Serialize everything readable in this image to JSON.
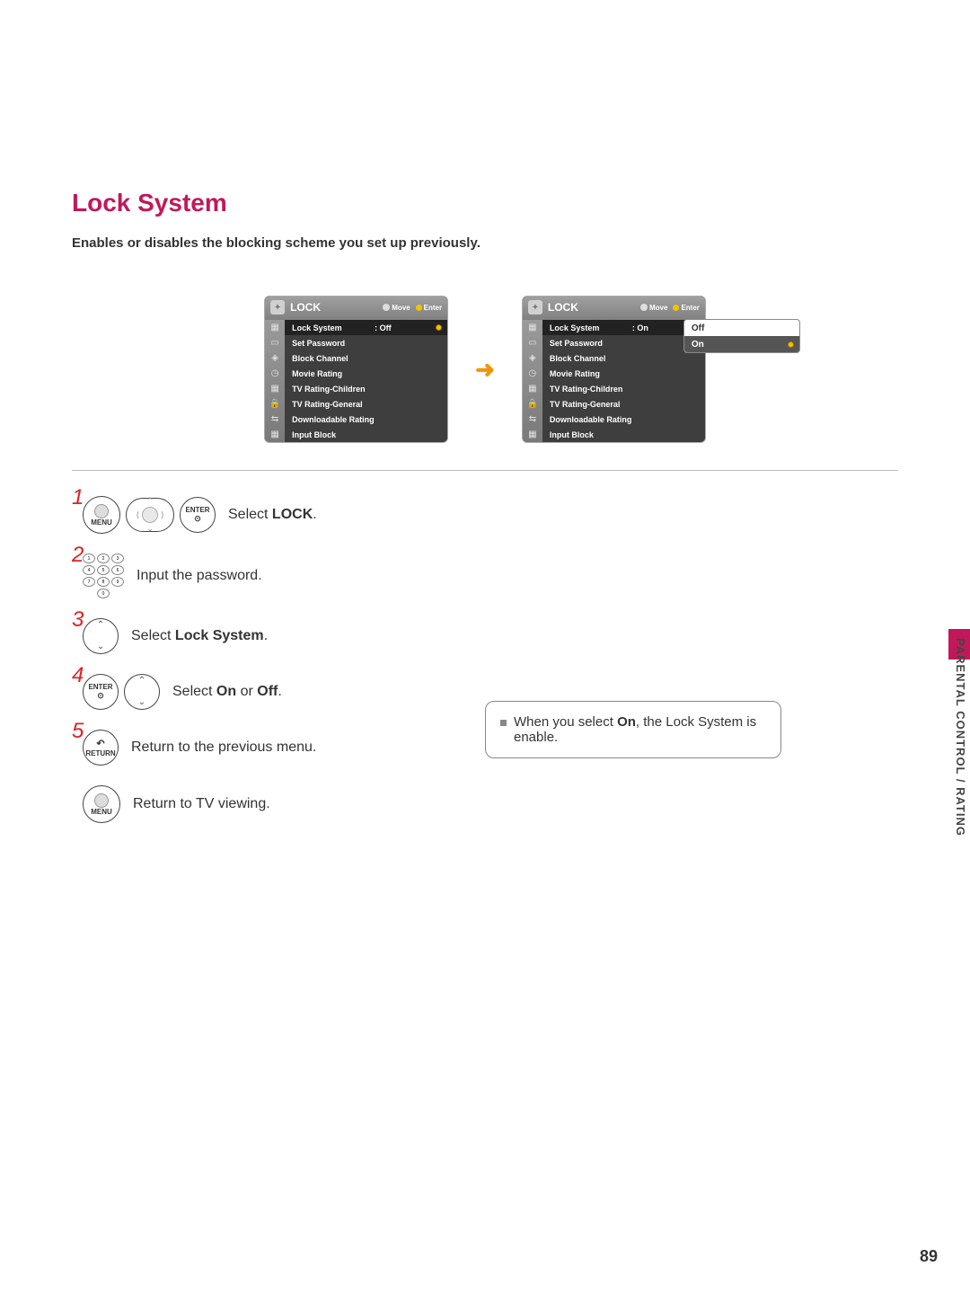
{
  "page": {
    "title": "Lock System",
    "subtitle": "Enables or disables the blocking scheme you set up previously.",
    "section_tab": "PARENTAL CONTROL / RATING",
    "page_number": "89"
  },
  "osd": {
    "header_title": "LOCK",
    "hint_move": "Move",
    "hint_enter": "Enter",
    "items": [
      "Lock System",
      "Set Password",
      "Block Channel",
      "Movie Rating",
      "TV Rating-Children",
      "TV Rating-General",
      "Downloadable Rating",
      "Input Block"
    ],
    "left_value_label": ": Off",
    "right_value_label": ": On",
    "submenu": {
      "options": [
        "Off",
        "On"
      ],
      "selected": "On"
    }
  },
  "buttons": {
    "menu": "MENU",
    "enter": "ENTER",
    "return": "RETURN",
    "keypad": [
      "1",
      "2",
      "3",
      "4",
      "5",
      "6",
      "7",
      "8",
      "9",
      "",
      "0",
      ""
    ]
  },
  "steps": {
    "nums": [
      "1",
      "2",
      "3",
      "4",
      "5"
    ],
    "s1_pre": "Select ",
    "s1_b": "LOCK",
    "s1_post": ".",
    "s2": "Input the password.",
    "s3_pre": "Select ",
    "s3_b": "Lock System",
    "s3_post": ".",
    "s4_pre": "Select ",
    "s4_b1": "On",
    "s4_mid": " or ",
    "s4_b2": "Off",
    "s4_post": ".",
    "s5": "Return to the previous menu.",
    "s6": "Return to TV viewing."
  },
  "note": {
    "pre": "When you select ",
    "b": "On",
    "post": ", the Lock System is enable."
  },
  "arrow": "➜"
}
